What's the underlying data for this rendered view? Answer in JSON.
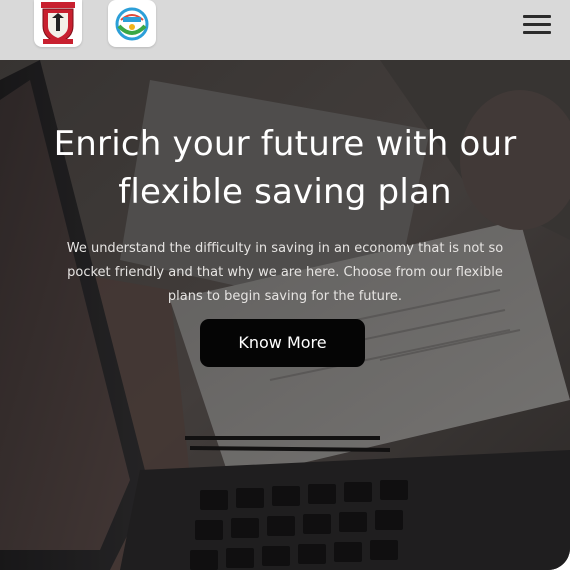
{
  "header": {
    "logo_primary": {
      "icon": "school-crest-logo",
      "color": "#c8202f"
    },
    "logo_secondary": {
      "icon": "circular-emblem-logo"
    },
    "menu_icon": "hamburger-menu-icon"
  },
  "hero": {
    "title": "Enrich your future with our flexible saving plan",
    "description": "We understand the difficulty in saving in an economy that is not so pocket friendly and that why we are here. Choose from our flexible plans to begin saving for the future.",
    "cta_label": "Know More",
    "background_image": "laptop-and-documents-on-desk"
  },
  "colors": {
    "header_bg": "#d9d9d9",
    "cta_bg": "#050505",
    "hero_text": "#ffffff"
  }
}
